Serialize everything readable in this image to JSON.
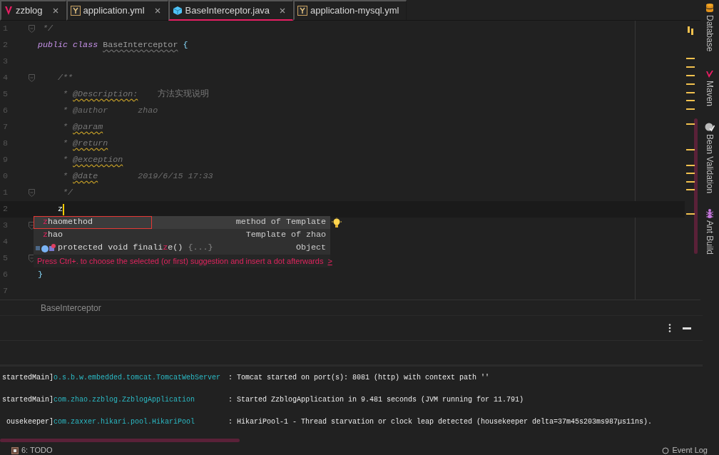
{
  "tabs": [
    {
      "label": "zzblog",
      "kind": "module",
      "selected": false
    },
    {
      "label": "application.yml",
      "kind": "yaml",
      "selected": false
    },
    {
      "label": "BaseInterceptor.java",
      "kind": "class",
      "selected": true
    },
    {
      "label": "application-mysql.yml",
      "kind": "yaml",
      "selected": false
    }
  ],
  "code_lines": [
    {
      "number": "1",
      "fold": true,
      "current": false,
      "tokens": [
        {
          "text": " */",
          "kind": "comment"
        }
      ]
    },
    {
      "number": "2",
      "fold": false,
      "current": false,
      "tokens": [
        {
          "text": "public class ",
          "kind": "keyword"
        },
        {
          "text": "BaseInterceptor",
          "kind": "classname"
        },
        {
          "text": " {",
          "kind": "brace"
        }
      ]
    },
    {
      "number": "3",
      "fold": false,
      "current": false
    },
    {
      "number": "4",
      "fold": true,
      "current": false,
      "tokens": [
        {
          "text": "    /**",
          "kind": "comment"
        }
      ]
    },
    {
      "number": "5",
      "fold": false,
      "current": false,
      "tokens": [
        {
          "text": "     * ",
          "kind": "comment"
        },
        {
          "text": "@Description:",
          "kind": "tag"
        },
        {
          "text": "    方法实现说明",
          "kind": "doc"
        }
      ]
    },
    {
      "number": "6",
      "fold": false,
      "current": false,
      "tokens": [
        {
          "text": "     * ",
          "kind": "comment"
        },
        {
          "text": "@author",
          "kind": "comment"
        },
        {
          "text": "      zhao",
          "kind": "comment"
        }
      ]
    },
    {
      "number": "7",
      "fold": false,
      "current": false,
      "tokens": [
        {
          "text": "     * ",
          "kind": "comment"
        },
        {
          "text": "@param",
          "kind": "tag"
        }
      ]
    },
    {
      "number": "8",
      "fold": false,
      "current": false,
      "tokens": [
        {
          "text": "     * ",
          "kind": "comment"
        },
        {
          "text": "@return",
          "kind": "tag"
        }
      ]
    },
    {
      "number": "9",
      "fold": false,
      "current": false,
      "tokens": [
        {
          "text": "     * ",
          "kind": "comment"
        },
        {
          "text": "@exception",
          "kind": "tag"
        }
      ]
    },
    {
      "number": "0",
      "fold": false,
      "current": false,
      "tokens": [
        {
          "text": "     * ",
          "kind": "comment"
        },
        {
          "text": "@date",
          "kind": "tag"
        },
        {
          "text": "        2019/6/15 17:33",
          "kind": "comment"
        }
      ]
    },
    {
      "number": "1",
      "fold": true,
      "current": false,
      "tokens": [
        {
          "text": "     */",
          "kind": "comment"
        }
      ]
    },
    {
      "number": "2",
      "fold": false,
      "current": true,
      "tokens": [
        {
          "text": "    z",
          "kind": "plain"
        }
      ]
    },
    {
      "number": "3",
      "fold": true,
      "current": false
    },
    {
      "number": "4",
      "fold": false,
      "current": false
    },
    {
      "number": "5",
      "fold": true,
      "current": false
    },
    {
      "number": "6",
      "fold": false,
      "current": false,
      "tokens": [
        {
          "text": "}",
          "kind": "brace"
        }
      ]
    },
    {
      "number": "7",
      "fold": false,
      "current": false
    }
  ],
  "completion": {
    "items": [
      {
        "kind": "template",
        "parts": [
          {
            "text": "z",
            "kind": "match"
          },
          {
            "text": "haomethod",
            "kind": "plain"
          }
        ],
        "type": "method of Template",
        "selected": true,
        "annotated": true
      },
      {
        "kind": "template",
        "parts": [
          {
            "text": "z",
            "kind": "match"
          },
          {
            "text": "hao",
            "kind": "plain"
          }
        ],
        "type": "Template of zhao",
        "selected": false,
        "annotated": false
      },
      {
        "kind": "method",
        "parts": [
          {
            "text": "protected void finali",
            "kind": "plain"
          },
          {
            "text": "z",
            "kind": "match"
          },
          {
            "text": "e() ",
            "kind": "plain"
          },
          {
            "text": "{...}",
            "kind": "dim"
          }
        ],
        "type": "Object",
        "selected": false,
        "annotated": false
      }
    ],
    "hint": "Press Ctrl+. to choose the selected (or first) suggestion and insert a dot afterwards",
    "hint_link": ">"
  },
  "breadcrumb": "BaseInterceptor",
  "tool_windows": [
    {
      "label": "Database",
      "kind": "database"
    },
    {
      "label": "Maven",
      "kind": "maven"
    },
    {
      "label": "Bean Validation",
      "kind": "bean"
    },
    {
      "label": "Ant Build",
      "kind": "ant"
    }
  ],
  "log_lines": [
    {
      "thread": "startedMain]",
      "logger": "o.s.b.w.embedded.tomcat.TomcatWebServer",
      "message": ": Tomcat started on port(s): 8081 (http) with context path ''"
    },
    {
      "thread": "startedMain]",
      "logger": "com.zhao.zzblog.ZzblogApplication",
      "message": ": Started ZzblogApplication in 9.481 seconds (JVM running for 11.791)"
    },
    {
      "thread": "ousekeeper]",
      "logger": "com.zaxxer.hikari.pool.HikariPool",
      "message": ": HikariPool-1 - Thread starvation or clock leap detected (housekeeper delta=37m45s203ms987µs11ns)."
    }
  ],
  "status_bar": {
    "left": "6: TODO",
    "right": "Event Log"
  }
}
